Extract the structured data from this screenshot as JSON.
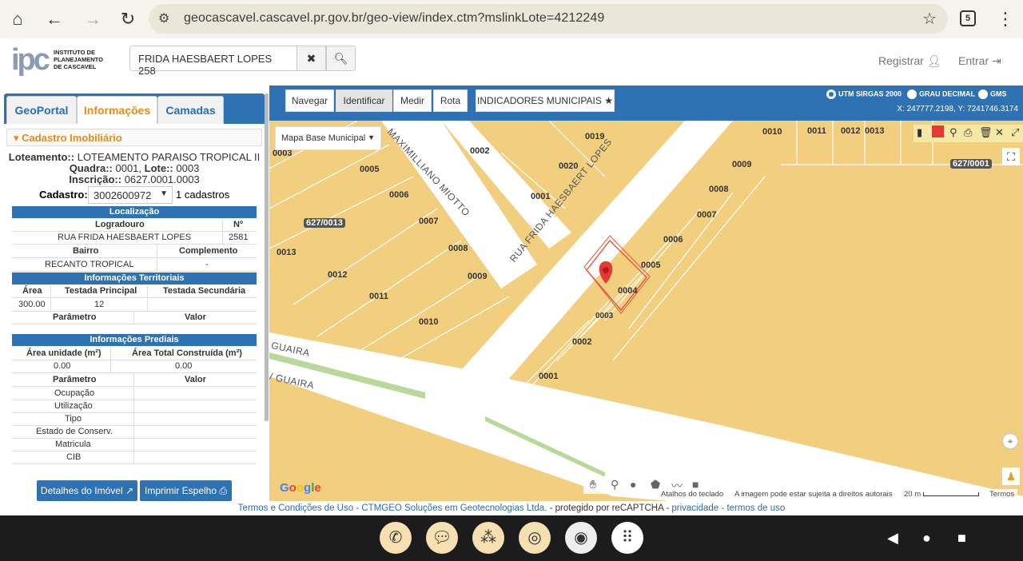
{
  "browser": {
    "url": "geocascavel.cascavel.pr.gov.br/geo-view/index.ctm?mslinkLote=4212249",
    "tab_count": "5"
  },
  "header": {
    "logo_letters": "ipc",
    "logo_text": [
      "INSTITUTO DE",
      "PLANEJAMENTO",
      "DE CASCAVEL"
    ],
    "search_value": "FRIDA HAESBAERT LOPES 258",
    "registrar": "Registrar",
    "entrar": "Entrar"
  },
  "tabs": [
    {
      "label": "GeoPortal"
    },
    {
      "label": "Informações"
    },
    {
      "label": "Camadas"
    }
  ],
  "cadastro": {
    "title": "Cadastro Imobiliário",
    "loteamento_label": "Loteamento::",
    "loteamento_value": "LOTEAMENTO PARAISO TROPICAL II",
    "quadra_label": "Quadra::",
    "quadra_value": "0001",
    "lote_label": "Lote::",
    "lote_value": "0003",
    "inscricao_label": "Inscrição::",
    "inscricao_value": "0627.0001.0003",
    "cadastro_label": "Cadastro::",
    "cadastro_value": "3002600972",
    "cadastro_count": "1 cadastros"
  },
  "localizacao": {
    "title": "Localização",
    "col_logradouro": "Logradouro",
    "col_numero": "Nº",
    "logradouro": "RUA FRIDA HAESBAERT LOPES",
    "numero": "2581",
    "col_bairro": "Bairro",
    "col_complemento": "Complemento",
    "bairro": "RECANTO TROPICAL",
    "complemento": "-"
  },
  "territoriais": {
    "title": "Informações Territoriais",
    "col_area": "Área",
    "col_testada_principal": "Testada Principal",
    "col_testada_secundaria": "Testada Secundária",
    "area": "300.00",
    "testada_principal": "12",
    "col_parametro": "Parâmetro",
    "col_valor": "Valor"
  },
  "prediais": {
    "title": "Informações Prediais",
    "col_area_unidade": "Área unidade (m²)",
    "col_area_total": "Área Total Construída (m²)",
    "area_unidade": "0.00",
    "area_total": "0.00",
    "col_parametro": "Parâmetro",
    "col_valor": "Valor",
    "parametros": [
      "Ocupação",
      "Utilização",
      "Tipo",
      "Estado de Conserv.",
      "Matricula",
      "CIB"
    ]
  },
  "buttons": {
    "detalhes": "Detalhes do Imóvel",
    "imprimir": "Imprimir Espelho"
  },
  "map": {
    "toolbar": [
      "Navegar",
      "Identificar",
      "Medir",
      "Rota"
    ],
    "indicadores": "INDICADORES MUNICIPAIS",
    "radios": [
      "UTM SIRGAS 2000",
      "GRAU DECIMAL",
      "GMS"
    ],
    "coords": "X: 247777.2198, Y: 7241746.3174",
    "base_select": "Mapa Base Municipal",
    "streets": [
      "RUA FRIDA HAESBAERT LOPES",
      "MAXIMILLIANO MIOTTO",
      "GUAIRA",
      "/ GUAIRA"
    ],
    "quadra_badges": [
      "627/0013",
      "627/0001"
    ],
    "lots": [
      "0003",
      "0005",
      "0006",
      "0007",
      "0008",
      "0009",
      "0010",
      "0011",
      "0012",
      "0013",
      "0002",
      "0020",
      "0019",
      "0001",
      "0002",
      "0001",
      "0003",
      "0004",
      "0005",
      "0006",
      "0007",
      "0008",
      "0009",
      "0010",
      "0011",
      "0012",
      "0013"
    ],
    "attribution": [
      "Atalhos do teclado",
      "A imagem pode estar sujeita a direitos autorais",
      "20 m",
      "Termos"
    ],
    "google": "Google"
  },
  "footer": {
    "terms": "Termos e Condições de Uso",
    "company": "CTMGEO Soluções em Geotecnologias Ltda.",
    "protected": "- protegido por reCAPTCHA -",
    "privacy": "privacidade",
    "terms2": "termos de uso"
  },
  "colors": {
    "primary": "#2f72b4",
    "accent": "#e88a17",
    "map_lot": "#f1cf7f",
    "map_road": "#ffffff",
    "highlight": "#e8533b"
  }
}
